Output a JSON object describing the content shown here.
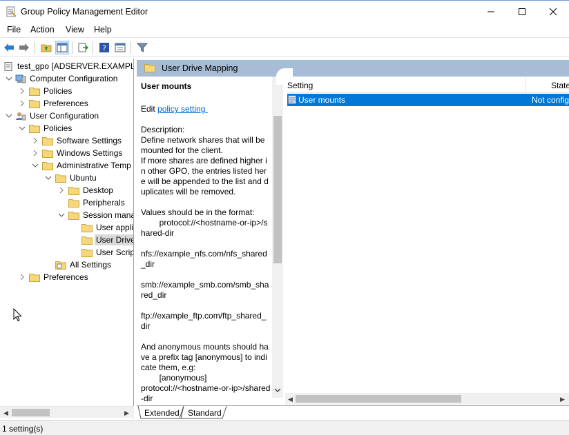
{
  "window": {
    "title": "Group Policy Management Editor"
  },
  "menu": {
    "file": "File",
    "action": "Action",
    "view": "View",
    "help": "Help"
  },
  "tree": {
    "root": "test_gpo [ADSERVER.EXAMPLE.C",
    "computer_config": "Computer Configuration",
    "cc_policies": "Policies",
    "cc_preferences": "Preferences",
    "user_config": "User Configuration",
    "uc_policies": "Policies",
    "software_settings": "Software Settings",
    "windows_settings": "Windows Settings",
    "admin_templates": "Administrative Temp",
    "ubuntu": "Ubuntu",
    "desktop": "Desktop",
    "peripherals": "Peripherals",
    "session_mgmt": "Session mana",
    "user_appli": "User appli",
    "user_drive": "User Drive",
    "user_scrip": "User Scrip",
    "all_settings": "All Settings",
    "uc_preferences": "Preferences"
  },
  "header": {
    "title": "User Drive Mapping"
  },
  "extended": {
    "policy_name": "User mounts",
    "edit_prefix": "Edit ",
    "edit_link": "policy setting ",
    "description": "Description:\nDefine network shares that will be mounted for the client.\nIf more shares are defined higher in other GPO, the entries listed here will be appended to the list and duplicates will be removed.\n\nValues should be in the format:\n        protocol://<hostname-or-ip>/shared-dir\n\nnfs://example_nfs.com/nfs_shared_dir\n\nsmb://example_smb.com/smb_shared_dir\n\nftp://example_ftp.com/ftp_shared_dir\n\nAnd anonymous mounts should have a prefix tag [anonymous] to indicate them, e.g:\n        [anonymous]\nprotocol://<hostname-or-ip>/shared-dir"
  },
  "list": {
    "col_setting": "Setting",
    "col_state": "State",
    "rows": [
      {
        "setting": "User mounts",
        "state": "Not config"
      }
    ]
  },
  "tabs": {
    "extended": "Extended",
    "standard": "Standard"
  },
  "status": {
    "text": "1 setting(s)"
  }
}
